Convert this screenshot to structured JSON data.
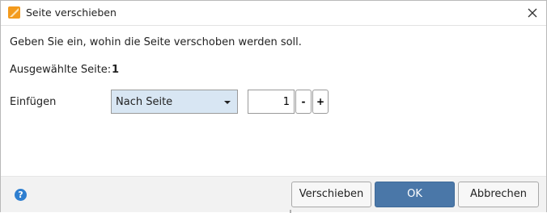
{
  "window": {
    "title": "Seite verschieben",
    "app_icon": "orange-app-icon",
    "close_icon": "close-icon"
  },
  "content": {
    "instruction": "Geben Sie ein, wohin die Seite verschoben werden soll.",
    "selected_page_label": "Ausgewählte Seite:",
    "selected_page_value": "1",
    "insert_label": "Einfügen",
    "position_select": {
      "value": "Nach Seite"
    },
    "page_number": {
      "value": "1",
      "decrement_label": "-",
      "increment_label": "+"
    }
  },
  "footer": {
    "help_icon": "help-icon",
    "help_glyph": "?",
    "buttons": {
      "move": "Verschieben",
      "ok": "OK",
      "cancel": "Abbrechen"
    }
  },
  "colors": {
    "ok_button": "#4a77a8",
    "select_bg": "#d8e6f3",
    "help_icon": "#2f7fd0",
    "app_icon": "#f39a1c"
  }
}
